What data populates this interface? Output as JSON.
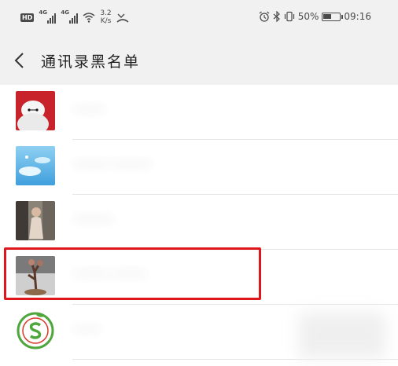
{
  "status_bar": {
    "hd_badge": "HD",
    "signal1_label": "4G",
    "signal2_label": "4G",
    "speed_value": "3.2",
    "speed_unit": "K/s",
    "battery_text": "50%",
    "battery_level": 0.5,
    "time": "09:16"
  },
  "header": {
    "title": "通讯录黑名单"
  },
  "contacts": [
    {
      "name": "·······",
      "avatar": "baymax-avatar"
    },
    {
      "name": "········ ·········",
      "avatar": "sky-avatar"
    },
    {
      "name": "·········",
      "avatar": "portrait-avatar"
    },
    {
      "name": "········ ········",
      "avatar": "tree-avatar"
    },
    {
      "name": "······",
      "avatar": "logo-avatar"
    }
  ],
  "colors": {
    "highlight": "#e0161d",
    "bar_background": "#f1f1f1"
  }
}
